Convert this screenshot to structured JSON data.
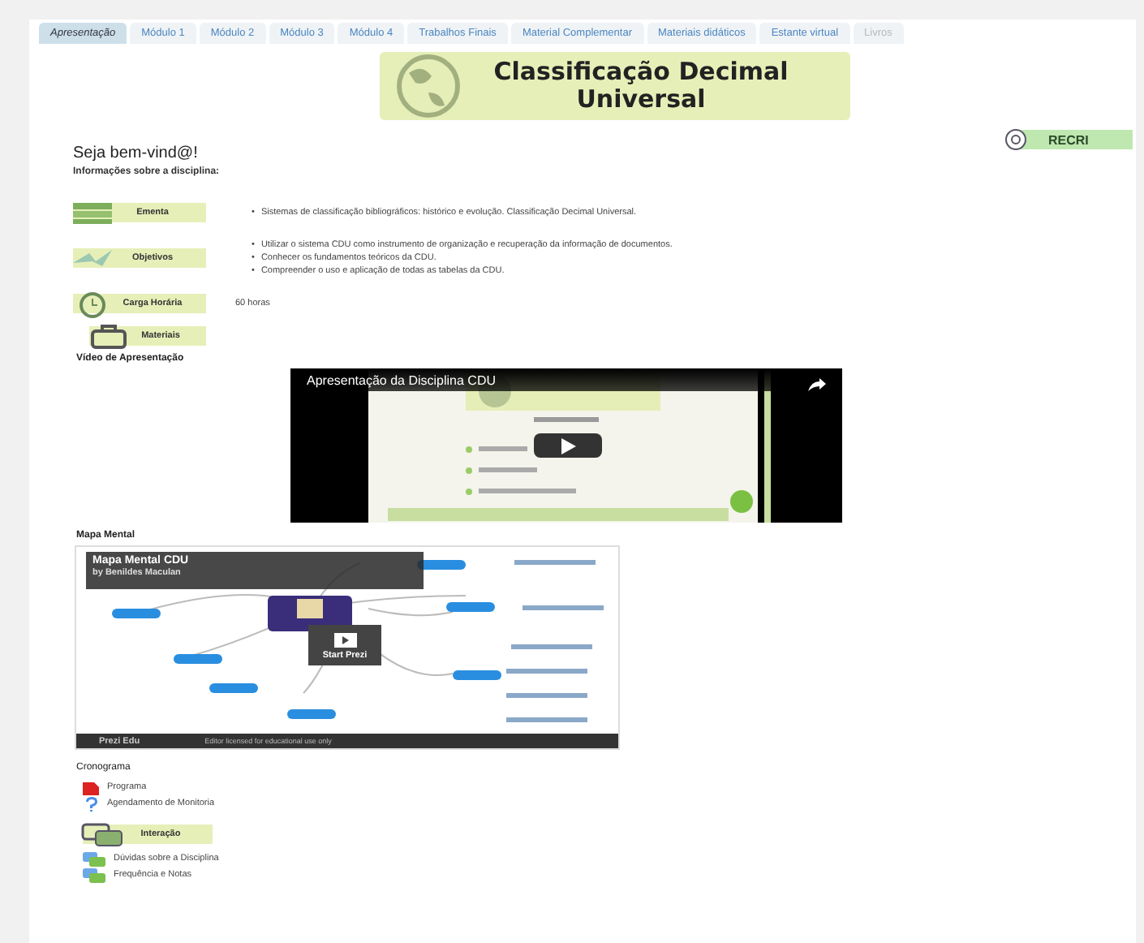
{
  "tabs": [
    {
      "label": "Apresentação",
      "selected": true,
      "disabled": false
    },
    {
      "label": "Módulo 1",
      "selected": false,
      "disabled": false
    },
    {
      "label": "Módulo 2",
      "selected": false,
      "disabled": false
    },
    {
      "label": "Módulo 3",
      "selected": false,
      "disabled": false
    },
    {
      "label": "Módulo 4",
      "selected": false,
      "disabled": false
    },
    {
      "label": "Trabalhos Finais",
      "selected": false,
      "disabled": false
    },
    {
      "label": "Material Complementar",
      "selected": false,
      "disabled": false
    },
    {
      "label": "Materiais didáticos",
      "selected": false,
      "disabled": false
    },
    {
      "label": "Estante virtual",
      "selected": false,
      "disabled": false
    },
    {
      "label": "Livros",
      "selected": false,
      "disabled": true
    }
  ],
  "banner": {
    "title": "Classificação Decimal Universal"
  },
  "badge": {
    "label": "RECRI"
  },
  "welcome": "Seja bem-vind@!",
  "info_heading": "Informações sobre a disciplina:",
  "info_rows": [
    {
      "label": "Ementa",
      "kind": "list",
      "marker": "•",
      "items": [
        "Sistemas de classificação bibliográficos: histórico e evolução. Classificação Decimal Universal."
      ]
    },
    {
      "label": "Objetivos",
      "kind": "list",
      "marker": "•",
      "items": [
        "Utilizar o sistema CDU como instrumento de organização e recuperação da informação de documentos.",
        "Conhecer os fundamentos teóricos da CDU.",
        "Compreender o uso e aplicação de todas as tabelas da CDU."
      ]
    },
    {
      "label": "Carga Horária",
      "kind": "text",
      "text": "60 horas"
    }
  ],
  "materials_label": "Materiais",
  "video": {
    "heading": "Vídeo de Apresentação",
    "title": "Apresentação da Disciplina CDU"
  },
  "mindmap": {
    "heading": "Mapa Mental",
    "title": "Mapa Mental CDU",
    "author": "by Benildes Maculan",
    "start": "Start Prezi",
    "brand": "Prezi Edu",
    "license": "Editor licensed for educational use only"
  },
  "schedule": {
    "heading": "Cronograma",
    "links": [
      {
        "label": "Programa",
        "kind": "pdf"
      },
      {
        "label": "Agendamento de Monitoria",
        "kind": "question"
      }
    ]
  },
  "interaction": {
    "label": "Interação",
    "links": [
      {
        "label": "Dúvidas sobre a Disciplina"
      },
      {
        "label": "Frequência e Notas"
      }
    ]
  }
}
